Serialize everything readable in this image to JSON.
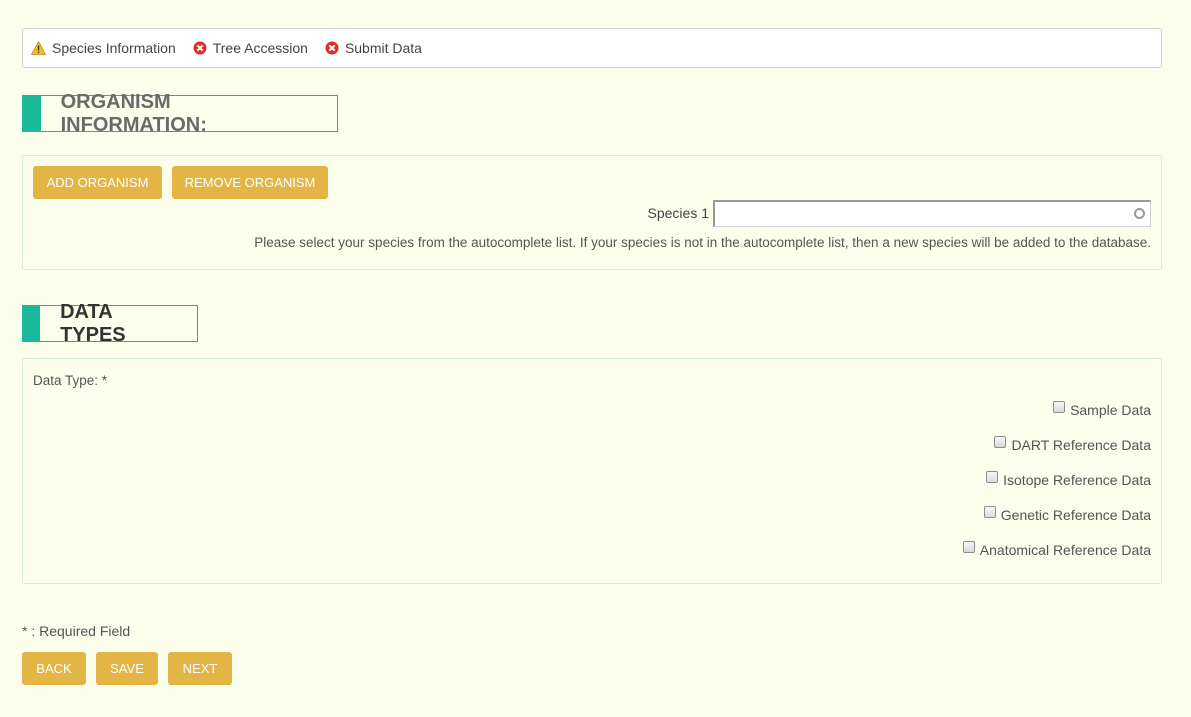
{
  "steps": [
    {
      "label": "Species Information",
      "status": "warning"
    },
    {
      "label": "Tree Accession",
      "status": "error"
    },
    {
      "label": "Submit Data",
      "status": "error"
    }
  ],
  "organism": {
    "title": "ORGANISM INFORMATION:",
    "add_label": "ADD ORGANISM",
    "remove_label": "REMOVE ORGANISM",
    "species_label": "Species 1",
    "species_value": "",
    "hint": "Please select your species from the autocomplete list. If your species is not in the autocomplete list, then a new species will be added to the database."
  },
  "data_types": {
    "title": "DATA TYPES",
    "label": "Data Type: *",
    "options": [
      {
        "label": "Sample Data",
        "checked": false
      },
      {
        "label": "DART Reference Data",
        "checked": false
      },
      {
        "label": "Isotope Reference Data",
        "checked": false
      },
      {
        "label": "Genetic Reference Data",
        "checked": false
      },
      {
        "label": "Anatomical Reference Data",
        "checked": false
      }
    ]
  },
  "footer": {
    "required_note": "* : Required Field",
    "back_label": "BACK",
    "save_label": "SAVE",
    "next_label": "NEXT"
  },
  "colors": {
    "background": "#fbfeeb",
    "button": "#e2b545",
    "accent_bar": "#1ab99a",
    "section_border": "#2aa8b8",
    "warning": "#f2c21a",
    "error": "#d9302c"
  }
}
